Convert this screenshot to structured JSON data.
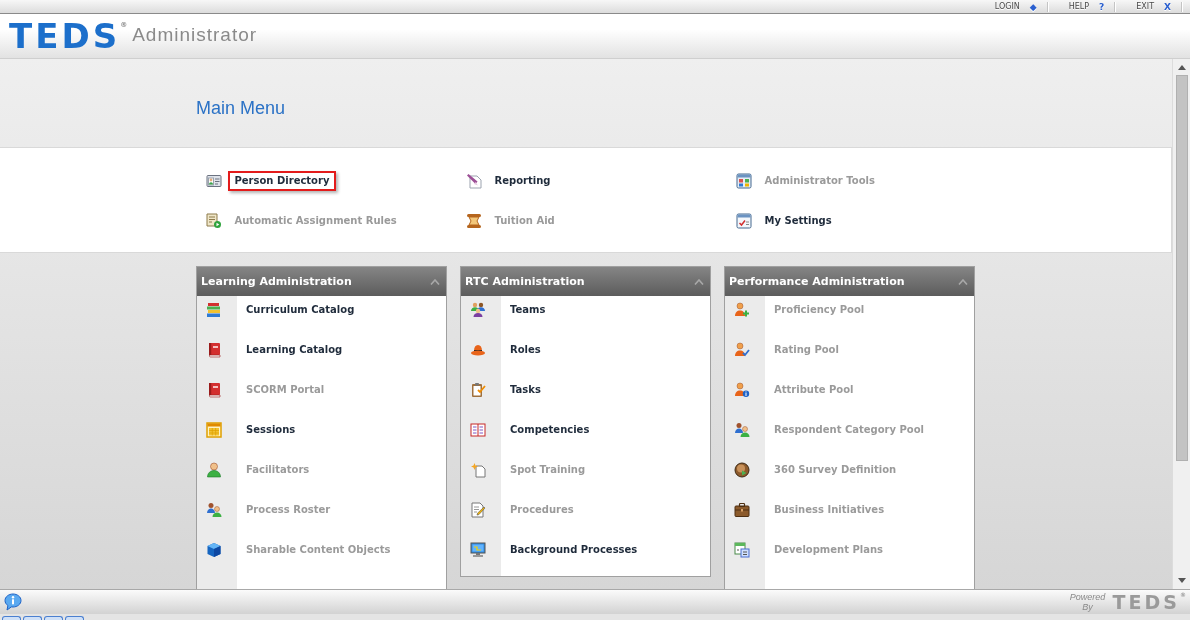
{
  "top_links": [
    {
      "label": "LOGIN",
      "glyph": "◆"
    },
    {
      "label": "HELP",
      "glyph": "?"
    },
    {
      "label": "EXIT",
      "glyph": "X"
    }
  ],
  "header": {
    "logo": "TEDS$^{®}$",
    "app_name": "Administrator"
  },
  "main_menu": {
    "title": "Main Menu",
    "items": [
      {
        "label": "Person Directory",
        "disabled": false,
        "selected": true
      },
      {
        "label": "Reporting",
        "disabled": false,
        "selected": false
      },
      {
        "label": "Administrator Tools",
        "disabled": true,
        "selected": false
      },
      {
        "label": "Automatic Assignment Rules",
        "disabled": true,
        "selected": false
      },
      {
        "label": "Tuition Aid",
        "disabled": true,
        "selected": false
      },
      {
        "label": "My Settings",
        "disabled": false,
        "selected": false
      }
    ]
  },
  "panels": [
    {
      "title": "Learning Administration",
      "expanded": true,
      "cut_off": true,
      "items": [
        {
          "label": "Curriculum Catalog",
          "disabled": false
        },
        {
          "label": "Learning Catalog",
          "disabled": false
        },
        {
          "label": "SCORM Portal",
          "disabled": true
        },
        {
          "label": "Sessions",
          "disabled": false
        },
        {
          "label": "Facilitators",
          "disabled": true
        },
        {
          "label": "Process Roster",
          "disabled": true
        },
        {
          "label": "Sharable Content Objects",
          "disabled": true
        }
      ]
    },
    {
      "title": "RTC Administration",
      "expanded": true,
      "cut_off": false,
      "items": [
        {
          "label": "Teams",
          "disabled": false
        },
        {
          "label": "Roles",
          "disabled": false
        },
        {
          "label": "Tasks",
          "disabled": false
        },
        {
          "label": "Competencies",
          "disabled": false
        },
        {
          "label": "Spot Training",
          "disabled": true
        },
        {
          "label": "Procedures",
          "disabled": true
        },
        {
          "label": "Background Processes",
          "disabled": false
        }
      ]
    },
    {
      "title": "Performance Administration",
      "expanded": true,
      "cut_off": true,
      "items": [
        {
          "label": "Proficiency Pool",
          "disabled": true
        },
        {
          "label": "Rating Pool",
          "disabled": true
        },
        {
          "label": "Attribute Pool",
          "disabled": true
        },
        {
          "label": "Respondent Category Pool",
          "disabled": true
        },
        {
          "label": "360 Survey Definition",
          "disabled": true
        },
        {
          "label": "Business Initiatives",
          "disabled": true
        },
        {
          "label": "Development Plans",
          "disabled": true
        }
      ]
    }
  ],
  "footer": {
    "powered_by": "Powered By",
    "logo": "TEDS$^{®}$"
  }
}
